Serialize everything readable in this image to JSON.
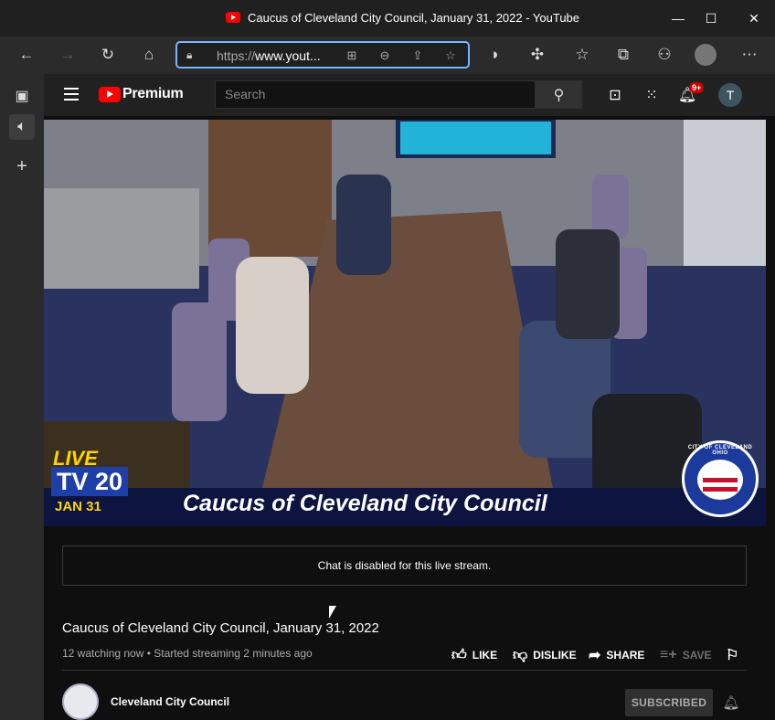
{
  "window": {
    "title": "Caucus of Cleveland City Council, January 31, 2022 - YouTube"
  },
  "addressbar": {
    "url_prefix": "https://",
    "url_host": "www.yout..."
  },
  "youtube": {
    "brand": "Premium",
    "search_placeholder": "Search",
    "notification_badge": "9+",
    "avatar_letter": "T"
  },
  "video_overlay": {
    "live": "LIVE",
    "channel_tv": "TV 20",
    "date": "JAN 31",
    "banner": "Caucus of Cleveland City Council",
    "seal_text": "CITY OF CLEVELAND OHIO"
  },
  "chat": {
    "message": "Chat is disabled for this live stream."
  },
  "video": {
    "title": "Caucus of Cleveland City Council, January 31, 2022",
    "meta": "12 watching now • Started streaming 2 minutes ago"
  },
  "actions": {
    "like": "LIKE",
    "dislike": "DISLIKE",
    "share": "SHARE",
    "save": "SAVE"
  },
  "channel": {
    "name": "Cleveland City Council",
    "subscribe_label": "SUBSCRIBED"
  },
  "colors": {
    "accent": "#ff0000",
    "address_focus": "#7cb4ff",
    "banner": "#0d1440"
  }
}
